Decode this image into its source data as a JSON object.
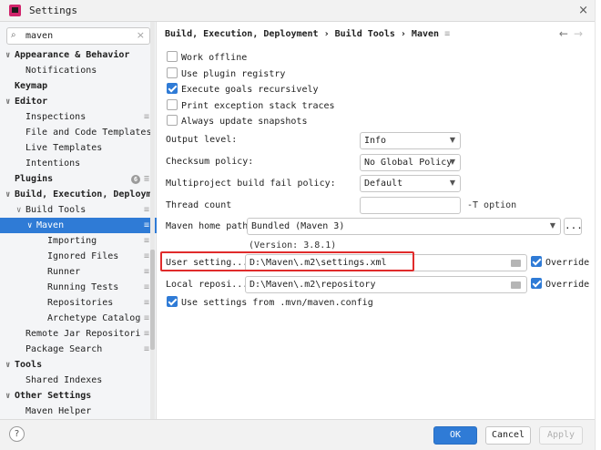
{
  "window": {
    "title": "Settings",
    "close": "×"
  },
  "search": {
    "value": "maven",
    "clear": "×"
  },
  "tree": [
    {
      "label": "Appearance & Behavior",
      "chev": "∨",
      "indent": 0,
      "bold": true
    },
    {
      "label": "Notifications",
      "indent": 1
    },
    {
      "label": "Keymap",
      "indent": 0,
      "bold": true
    },
    {
      "label": "Editor",
      "chev": "∨",
      "indent": 0,
      "bold": true
    },
    {
      "label": "Inspections",
      "indent": 1,
      "cfg": true
    },
    {
      "label": "File and Code Templates",
      "indent": 1
    },
    {
      "label": "Live Templates",
      "indent": 1
    },
    {
      "label": "Intentions",
      "indent": 1
    },
    {
      "label": "Plugins",
      "indent": 0,
      "bold": true,
      "badge": "6",
      "cfg": true
    },
    {
      "label": "Build, Execution, Deploym",
      "chev": "∨",
      "indent": 0,
      "bold": true
    },
    {
      "label": "Build Tools",
      "chev": "∨",
      "indent": 1,
      "cfg": true
    },
    {
      "label": "Maven",
      "chev": "∨",
      "indent": 2,
      "cfg": true,
      "selected": true
    },
    {
      "label": "Importing",
      "indent": 3,
      "cfg": true
    },
    {
      "label": "Ignored Files",
      "indent": 3,
      "cfg": true
    },
    {
      "label": "Runner",
      "indent": 3,
      "cfg": true
    },
    {
      "label": "Running Tests",
      "indent": 3,
      "cfg": true
    },
    {
      "label": "Repositories",
      "indent": 3,
      "cfg": true
    },
    {
      "label": "Archetype Catalog",
      "indent": 3,
      "cfg": true
    },
    {
      "label": "Remote Jar Repositori",
      "indent": 1,
      "cfg": true
    },
    {
      "label": "Package Search",
      "indent": 1,
      "cfg": true
    },
    {
      "label": "Tools",
      "chev": "∨",
      "indent": 0,
      "bold": true
    },
    {
      "label": "Shared Indexes",
      "indent": 1
    },
    {
      "label": "Other Settings",
      "chev": "∨",
      "indent": 0,
      "bold": true
    },
    {
      "label": "Maven Helper",
      "indent": 1
    }
  ],
  "main": {
    "breadcrumb": "Build, Execution, Deployment › Build Tools › Maven",
    "checkboxes": [
      {
        "label": "Work offline",
        "checked": false
      },
      {
        "label": "Use plugin registry",
        "checked": false
      },
      {
        "label": "Execute goals recursively",
        "checked": true
      },
      {
        "label": "Print exception stack traces",
        "checked": false
      },
      {
        "label": "Always update snapshots",
        "checked": false
      }
    ],
    "output_level": {
      "label": "Output level:",
      "value": "Info"
    },
    "checksum_policy": {
      "label": "Checksum policy:",
      "value": "No Global Policy"
    },
    "fail_policy": {
      "label": "Multiproject build fail policy:",
      "value": "Default"
    },
    "thread_count": {
      "label": "Thread count",
      "value": "",
      "hint": "-T option"
    },
    "maven_home": {
      "label": "Maven home path:",
      "value": "Bundled (Maven 3)",
      "version": "(Version: 3.8.1)",
      "more": "..."
    },
    "user_settings": {
      "label": "User setting...",
      "value": "D:\\Maven\\.m2\\settings.xml",
      "override": "Override",
      "override_checked": true
    },
    "local_repo": {
      "label": "Local reposi...",
      "value": "D:\\Maven\\.m2\\repository",
      "override": "Override",
      "override_checked": true
    },
    "use_mvn_config": {
      "label": "Use settings from .mvn/maven.config",
      "checked": true
    }
  },
  "footer": {
    "help": "?",
    "ok": "OK",
    "cancel": "Cancel",
    "apply": "Apply"
  },
  "colors": {
    "accent": "#2f7bd6",
    "highlight": "#e02b2b"
  }
}
